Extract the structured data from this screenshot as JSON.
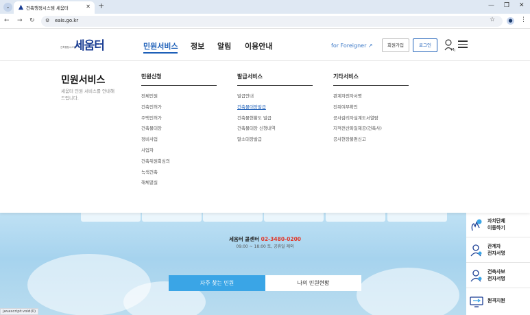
{
  "browser": {
    "tab_title": "건축행정시스템 세움터",
    "url": "eais.go.kr"
  },
  "header": {
    "logo_sub": "건축행정시스템",
    "logo_main": "세움터",
    "nav": [
      "민원서비스",
      "정보",
      "알림",
      "이용안내"
    ],
    "foreigner": "for Foreigner",
    "join": "회원가입",
    "login": "로그인"
  },
  "mega_menu": {
    "title": "민원서비스",
    "desc": "세움터 민원 서비스를 안내해드립니다.",
    "columns": [
      {
        "heading": "민원신청",
        "items": [
          "전체민원",
          "건축인허가",
          "주택인허가",
          "건축물대장",
          "정비사업",
          "사업자",
          "건축위원회심의",
          "녹색건축",
          "해체멸실"
        ]
      },
      {
        "heading": "발급서비스",
        "items": [
          "발급안내",
          "건축물대장발급",
          "건축물현황도 발급",
          "건축물대장 신청내역",
          "말소대장발급"
        ]
      },
      {
        "heading": "기타서비스",
        "items": [
          "관계자전자서명",
          "진위여부확인",
          "공사감리자설계도서열람",
          "지적전산파일제공(건축사)",
          "공사현장불편신고"
        ]
      }
    ]
  },
  "main": {
    "callcenter_label": "세움터 콜센터",
    "callcenter_phone": "02-3480-0200",
    "hours": "09:00 ~ 18:00 토, 공휴일 제외",
    "faq_button": "자주 찾는 민원",
    "my_status_button": "나의 민원현황"
  },
  "side_panel": [
    {
      "line1": "자치단체",
      "line2": "이동하기",
      "icon": "map-pin-icon"
    },
    {
      "line1": "관계자",
      "line2": "전자서명",
      "icon": "person-sign-icon"
    },
    {
      "line1": "건축사보",
      "line2": "전자서명",
      "icon": "person-sign-icon"
    },
    {
      "line1": "원격지원",
      "line2": "",
      "icon": "remote-support-icon"
    }
  ],
  "status_bar": "javascript:void(0)"
}
